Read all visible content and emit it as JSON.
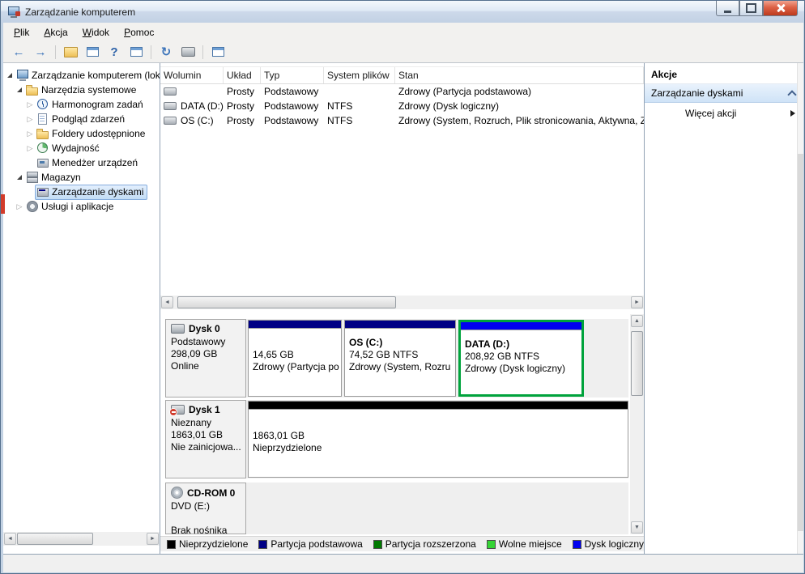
{
  "window": {
    "title": "Zarządzanie komputerem",
    "controls": [
      {
        "name": "minimize"
      },
      {
        "name": "maximize"
      },
      {
        "name": "close"
      }
    ]
  },
  "menubar": {
    "items": [
      {
        "label": "Plik"
      },
      {
        "label": "Akcja"
      },
      {
        "label": "Widok"
      },
      {
        "label": "Pomoc"
      }
    ]
  },
  "toolbar": {
    "buttons": [
      {
        "name": "back-icon",
        "glyph": "←"
      },
      {
        "name": "forward-icon",
        "glyph": "→"
      },
      {
        "name": "show-console-tree-icon",
        "glyph": ""
      },
      {
        "name": "properties-window-icon",
        "glyph": ""
      },
      {
        "name": "help-icon",
        "glyph": "?"
      },
      {
        "name": "console-window-icon",
        "glyph": ""
      },
      {
        "name": "refresh-icon",
        "glyph": "↻"
      },
      {
        "name": "rescan-disks-icon",
        "glyph": ""
      },
      {
        "name": "disk-properties-icon",
        "glyph": ""
      }
    ]
  },
  "tree": {
    "items": [
      {
        "label": "Zarządzanie komputerem (loka",
        "level": 0,
        "expanded": true,
        "icon": "computer-management-icon"
      },
      {
        "label": "Narzędzia systemowe",
        "level": 1,
        "expanded": true,
        "icon": "system-tools-icon"
      },
      {
        "label": "Harmonogram zadań",
        "level": 2,
        "expanded": false,
        "icon": "task-scheduler-icon"
      },
      {
        "label": "Podgląd zdarzeń",
        "level": 2,
        "expanded": false,
        "icon": "event-viewer-icon"
      },
      {
        "label": "Foldery udostępnione",
        "level": 2,
        "expanded": false,
        "icon": "shared-folders-icon"
      },
      {
        "label": "Wydajność",
        "level": 2,
        "expanded": false,
        "icon": "performance-icon"
      },
      {
        "label": "Menedżer urządzeń",
        "level": 2,
        "icon": "device-manager-icon"
      },
      {
        "label": "Magazyn",
        "level": 1,
        "expanded": true,
        "icon": "storage-icon"
      },
      {
        "label": "Zarządzanie dyskami",
        "level": 2,
        "selected": true,
        "icon": "disk-management-icon"
      },
      {
        "label": "Usługi i aplikacje",
        "level": 1,
        "expanded": false,
        "icon": "services-icon"
      }
    ]
  },
  "volume_table": {
    "columns": [
      "Wolumin",
      "Układ",
      "Typ",
      "System plików",
      "Stan"
    ],
    "rows": [
      {
        "cells": [
          "",
          "Prosty",
          "Podstawowy",
          "",
          "Zdrowy (Partycja podstawowa)"
        ]
      },
      {
        "cells": [
          "DATA (D:)",
          "Prosty",
          "Podstawowy",
          "NTFS",
          "Zdrowy (Dysk logiczny)"
        ]
      },
      {
        "cells": [
          "OS (C:)",
          "Prosty",
          "Podstawowy",
          "NTFS",
          "Zdrowy (System, Rozruch, Plik stronicowania, Aktywna, Z"
        ]
      }
    ]
  },
  "disk_view": {
    "selection_border_color": "#00a33c",
    "disks": [
      {
        "name": "Dysk 0",
        "info_lines": [
          "Podstawowy",
          "298,09 GB",
          "Online"
        ],
        "partitions": [
          {
            "title": "",
            "size": "14,65 GB",
            "status": "Zdrowy (Partycja po",
            "type_color": "#000084",
            "selected": false
          },
          {
            "title": "OS (C:)",
            "size": "74,52 GB NTFS",
            "status": "Zdrowy (System, Rozru",
            "type_color": "#000084",
            "selected": false
          },
          {
            "title": "DATA (D:)",
            "size": "208,92 GB NTFS",
            "status": "Zdrowy (Dysk logiczny)",
            "type_color": "#0000f0",
            "selected": true
          }
        ]
      },
      {
        "name": "Dysk 1",
        "info_lines": [
          "Nieznany",
          "1863,01 GB",
          "Nie zainicjowa..."
        ],
        "partitions": [
          {
            "title": "",
            "size": "1863,01 GB",
            "status": "Nieprzydzielone",
            "type_color": "#000000",
            "selected": false
          }
        ]
      },
      {
        "name": "CD-ROM 0",
        "info_lines": [
          "DVD (E:)",
          "",
          "Brak nośnika"
        ],
        "partitions": []
      }
    ]
  },
  "legend": {
    "items": [
      {
        "label": "Nieprzydzielone",
        "color": "#000000"
      },
      {
        "label": "Partycja podstawowa",
        "color": "#000084"
      },
      {
        "label": "Partycja rozszerzona",
        "color": "#007a00"
      },
      {
        "label": "Wolne miejsce",
        "color": "#35d435"
      },
      {
        "label": "Dysk logiczny",
        "color": "#0000f0"
      }
    ]
  },
  "actions": {
    "title": "Akcje",
    "group_label": "Zarządzanie dyskami",
    "more_label": "Więcej akcji"
  },
  "statusbar": {
    "text": ""
  }
}
